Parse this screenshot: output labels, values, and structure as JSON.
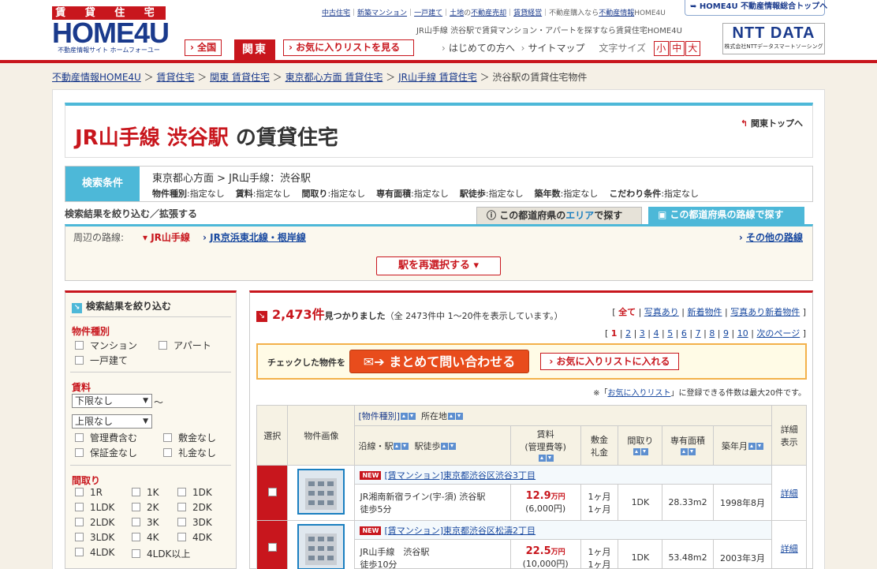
{
  "logo": {
    "top": "賃 貸 住 宅",
    "main": "HOME4U",
    "sub": "不動産情報サイト ホームフォーユー"
  },
  "toplinks": [
    {
      "label": "中古住宅",
      "sep": "｜"
    },
    {
      "label": "新築マンション",
      "sep": "｜"
    },
    {
      "label": "一戸建て",
      "sep": "｜"
    },
    {
      "label": "土地",
      "sep": "の"
    },
    {
      "label": "不動産売却",
      "sep": "｜"
    },
    {
      "label": "賃貸経営",
      "sep": "｜不動産購入なら"
    },
    {
      "label": "不動産情報",
      "sep": "HOME4U"
    }
  ],
  "tagline": "JR山手線 渋谷駅で賃貸マンション・アパートを探すなら賃貸住宅HOME4U",
  "home4u_top": "HOME4U 不動産情報総合トップへ",
  "ntt": {
    "logo": "NTT DATA",
    "sub": "株式会社NTTデータスマートソーシング"
  },
  "header_buttons": {
    "all": "全国",
    "kanto": "関東",
    "favorites": "お気に入りリストを見る"
  },
  "nav": {
    "first": "はじめての方へ",
    "sitemap": "サイトマップ",
    "font_size": "文字サイズ",
    "sizes": [
      "小",
      "中",
      "大"
    ]
  },
  "breadcrumb": [
    "不動産情報HOME4U",
    "賃貸住宅",
    "関東 賃貸住宅",
    "東京都心方面 賃貸住宅",
    "JR山手線 賃貸住宅",
    "渋谷駅の賃貸住宅物件"
  ],
  "title": {
    "line": "JR山手線",
    "station": "渋谷駅",
    "rest": "の賃貸住宅",
    "kanto_top": "関東トップへ"
  },
  "conditions": {
    "label": "検索条件",
    "area": "東京都心方面 > JR山手線：渋谷駅",
    "items": [
      {
        "k": "物件種別",
        "v": "指定なし"
      },
      {
        "k": "賃料",
        "v": "指定なし"
      },
      {
        "k": "間取り",
        "v": "指定なし"
      },
      {
        "k": "専有面積",
        "v": "指定なし"
      },
      {
        "k": "駅徒歩",
        "v": "指定なし"
      },
      {
        "k": "築年数",
        "v": "指定なし"
      },
      {
        "k": "こだわり条件",
        "v": "指定なし"
      }
    ]
  },
  "narrow": {
    "title": "検索結果を絞り込む／拡張する",
    "tab_area_pre": "この都道府県の",
    "tab_area_em": "エリア",
    "tab_area_post": "で探す",
    "tab_route": "この都道府県の路線で探す"
  },
  "routes": {
    "label": "周辺の路線:",
    "current": "JR山手線",
    "other": "JR京浜東北線・根岸線",
    "more": "その他の路線",
    "reselect": "駅を再選択する"
  },
  "sidebar": {
    "title": "検索結果を絞り込む",
    "type_h": "物件種別",
    "types": [
      "マンション",
      "アパート",
      "一戸建て"
    ],
    "rent_h": "賃料",
    "rent_min": "下限なし",
    "rent_tilde": "～",
    "rent_max": "上限なし",
    "rent_opts": [
      "管理費含む",
      "敷金なし",
      "保証金なし",
      "礼金なし"
    ],
    "layout_h": "間取り",
    "layouts": [
      "1R",
      "1K",
      "1DK",
      "1LDK",
      "2K",
      "2DK",
      "2LDK",
      "3K",
      "3DK",
      "3LDK",
      "4K",
      "4DK",
      "4LDK",
      "4LDK以上"
    ]
  },
  "results": {
    "count": "2,473件",
    "found": "見つかりました",
    "detail": "（全 2473件中 1～20件を表示しています。）",
    "filters": [
      "全て",
      "写真あり",
      "新着物件",
      "写真あり新着物件"
    ],
    "pages": [
      "1",
      "2",
      "3",
      "4",
      "5",
      "6",
      "7",
      "8",
      "9",
      "10"
    ],
    "next": "次のページ",
    "bulk_label": "チェックした物件を",
    "bulk_contact": "まとめて問い合わせる",
    "bulk_fav": "お気に入りリストに入れる",
    "fav_note_pre": "※「",
    "fav_note_link": "お気に入りリスト",
    "fav_note_post": "」に登録できる件数は最大20件です。"
  },
  "table": {
    "h_select": "選択",
    "h_photo": "物件画像",
    "h_type": "[物件種別]",
    "h_loc": "所在地",
    "h_line": "沿線・駅",
    "h_walk": "駅徒歩",
    "h_rent": "賃料",
    "h_rent_sub": "(管理費等)",
    "h_deposit": "敷金",
    "h_deposit2": "礼金",
    "h_layout": "間取り",
    "h_area": "専有面積",
    "h_built": "築年月",
    "h_detail": "詳細",
    "h_detail2": "表示",
    "rows": [
      {
        "new": "NEW",
        "title": "[賃マンション]東京都渋谷区渋谷3丁目",
        "line": "JR湘南新宿ライン(宇-須) 渋谷駅",
        "walk": "徒歩5分",
        "rent": "12.9",
        "unit": "万円",
        "fee": "(6,000円)",
        "deposit": "1ヶ月",
        "key": "1ヶ月",
        "layout": "1DK",
        "area": "28.33m2",
        "built": "1998年8月",
        "detail": "詳細"
      },
      {
        "new": "NEW",
        "title": "[賃マンション]東京都渋谷区松濤2丁目",
        "line": "JR山手線　渋谷駅",
        "walk": "徒歩10分",
        "rent": "22.5",
        "unit": "万円",
        "fee": "(10,000円)",
        "deposit": "1ヶ月",
        "key": "1ヶ月",
        "layout": "1DK",
        "area": "53.48m2",
        "built": "2003年3月",
        "detail": "詳細"
      }
    ]
  }
}
